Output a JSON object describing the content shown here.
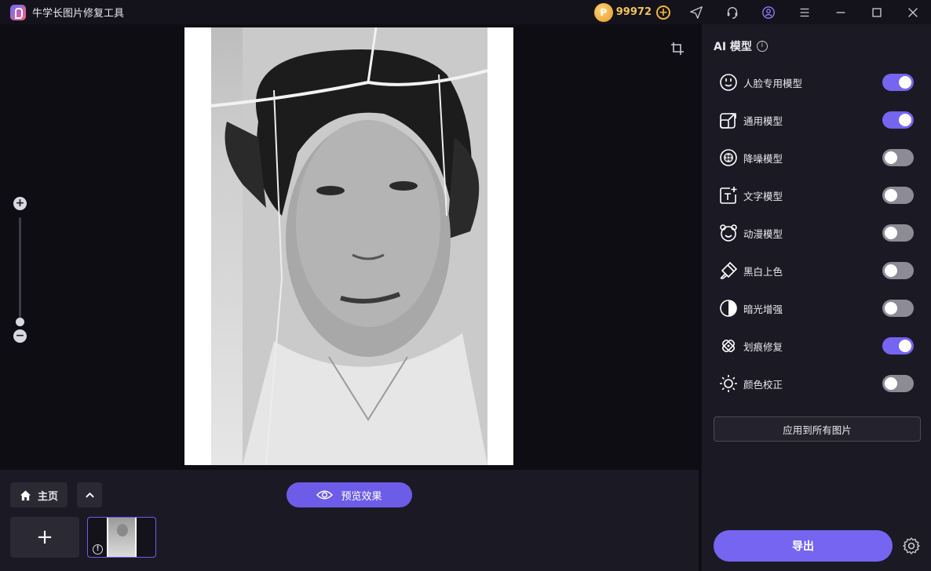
{
  "window": {
    "title": "牛学长图片修复工具"
  },
  "titlebar": {
    "coin_symbol": "P",
    "coin_count": "99972",
    "coin_plus": "+"
  },
  "canvas": {
    "zoom_plus": "+",
    "zoom_minus": "−",
    "zoom_level": 0.1
  },
  "bottom": {
    "home_label": "主页",
    "preview_label": "预览效果",
    "add_label": "+",
    "thumb_info": "!"
  },
  "panel": {
    "title": "AI 模型",
    "info": "i",
    "models": [
      {
        "label": "人脸专用模型",
        "icon": "face-icon",
        "enabled": true
      },
      {
        "label": "通用模型",
        "icon": "expand-icon",
        "enabled": true
      },
      {
        "label": "降噪模型",
        "icon": "noise-icon",
        "enabled": false
      },
      {
        "label": "文字模型",
        "icon": "text-icon",
        "enabled": false
      },
      {
        "label": "动漫模型",
        "icon": "anime-icon",
        "enabled": false
      },
      {
        "label": "黑白上色",
        "icon": "brush-icon",
        "enabled": false
      },
      {
        "label": "暗光增强",
        "icon": "contrast-icon",
        "enabled": false
      },
      {
        "label": "划痕修复",
        "icon": "scratch-icon",
        "enabled": true
      },
      {
        "label": "颜色校正",
        "icon": "sun-icon",
        "enabled": false
      }
    ],
    "apply_label": "应用到所有图片",
    "export_label": "导出"
  },
  "colors": {
    "accent": "#7565f0",
    "toggle_off": "#8d8c96",
    "coin": "#f0c25a"
  }
}
